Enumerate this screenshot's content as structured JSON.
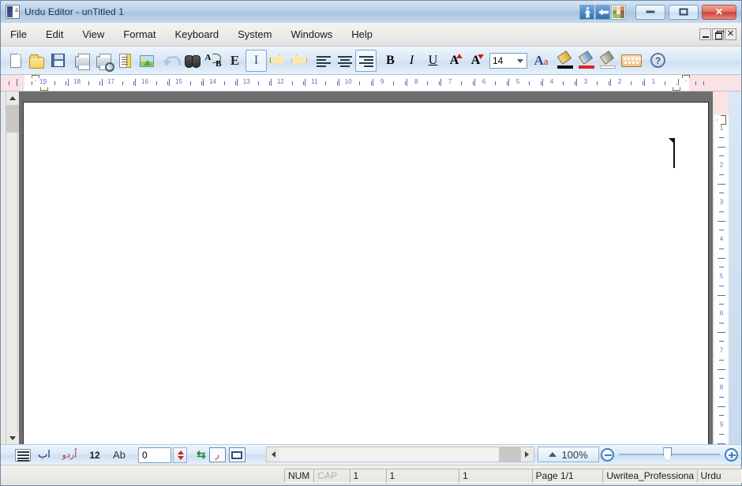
{
  "window": {
    "title": "Urdu Editor - unTitled 1",
    "app_icon": "urdu-editor-icon",
    "title_tools": [
      "person-icon",
      "left-arrow-icon",
      "color-palette-icon"
    ],
    "minimize_label": "",
    "maximize_label": "",
    "close_label": "✕"
  },
  "menu": {
    "items": [
      {
        "label": "File",
        "name": "menu-file"
      },
      {
        "label": "Edit",
        "name": "menu-edit"
      },
      {
        "label": "View",
        "name": "menu-view"
      },
      {
        "label": "Format",
        "name": "menu-format"
      },
      {
        "label": "Keyboard",
        "name": "menu-keyboard"
      },
      {
        "label": "System",
        "name": "menu-system"
      },
      {
        "label": "Windows",
        "name": "menu-windows"
      },
      {
        "label": "Help",
        "name": "menu-help"
      }
    ],
    "mdi": {
      "restore_title": "Restore",
      "minimize_title": "Minimize",
      "close_title": "Close",
      "close_glyph": "✕"
    }
  },
  "toolbar": {
    "buttons": [
      {
        "name": "new-document-button",
        "tip": "New"
      },
      {
        "name": "open-button",
        "tip": "Open"
      },
      {
        "name": "save-button",
        "tip": "Save"
      },
      {
        "name": "print-button",
        "tip": "Print"
      },
      {
        "name": "print-preview-button",
        "tip": "Print Preview"
      },
      {
        "name": "document-properties-button",
        "tip": "Document"
      },
      {
        "name": "insert-image-button",
        "tip": "Insert Image"
      },
      {
        "name": "undo-button",
        "tip": "Undo"
      },
      {
        "name": "find-button",
        "tip": "Find"
      },
      {
        "name": "replace-button",
        "tip": "Replace"
      },
      {
        "name": "english-mode-button",
        "tip": "English"
      },
      {
        "name": "urdu-mode-button",
        "tip": "Urdu"
      },
      {
        "name": "rtl-direction-button",
        "tip": "Right to Left"
      },
      {
        "name": "ltr-direction-button",
        "tip": "Left to Right"
      },
      {
        "name": "align-left-button",
        "tip": "Align Left"
      },
      {
        "name": "align-center-button",
        "tip": "Align Center"
      },
      {
        "name": "align-right-button",
        "tip": "Align Right"
      },
      {
        "name": "bold-button",
        "tip": "Bold"
      },
      {
        "name": "italic-button",
        "tip": "Italic"
      },
      {
        "name": "underline-button",
        "tip": "Underline"
      },
      {
        "name": "increase-font-button",
        "tip": "Increase Font Size"
      },
      {
        "name": "decrease-font-button",
        "tip": "Decrease Font Size"
      }
    ],
    "glyphs": {
      "english": "E",
      "urdu_info": "I",
      "bold": "B",
      "italic": "I",
      "underline": "U",
      "font_up": "A",
      "font_down": "A"
    },
    "font_size": {
      "value": "14",
      "placeholder": "14"
    },
    "font_button": {
      "big": "A",
      "small": "a"
    },
    "color_buttons": [
      {
        "name": "text-color-button",
        "color": "#000000"
      },
      {
        "name": "highlight-color-button",
        "color": "#e02020"
      },
      {
        "name": "background-color-button",
        "color": "#ffffff"
      }
    ],
    "keyboard_button": "on-screen-keyboard-button",
    "help_button": {
      "name": "help-button",
      "glyph": "?"
    }
  },
  "ruler": {
    "horizontal_numbers": [
      19,
      18,
      17,
      16,
      15,
      14,
      13,
      12,
      11,
      10,
      9,
      8,
      7,
      6,
      5,
      4,
      3,
      2,
      1
    ],
    "vertical_numbers": [
      1,
      2,
      3,
      4,
      5,
      6,
      7,
      8,
      9
    ]
  },
  "document": {
    "content": "",
    "caret_visible": true
  },
  "bottom_toolbar": {
    "items": [
      {
        "name": "line-spacing-button",
        "label": ""
      },
      {
        "name": "urdu-keyboard-button",
        "label": "اب"
      },
      {
        "name": "urdu-script-button",
        "label": "اُردو"
      },
      {
        "name": "line-number-display",
        "label": "12"
      },
      {
        "name": "case-button",
        "label": "Ab"
      }
    ],
    "spinner": {
      "name": "indent-spinner",
      "value": "0"
    },
    "extra_buttons": [
      {
        "name": "sync-button",
        "glyph": "⇆"
      },
      {
        "name": "urdu-convert-button",
        "glyph": ""
      },
      {
        "name": "window-preview-button",
        "glyph": ""
      }
    ]
  },
  "scrollbars": {
    "h_left_arrow": "‹",
    "h_right_arrow": "›",
    "v_up_arrow": "▲",
    "v_down_arrow": "▼"
  },
  "zoom": {
    "label": "100%",
    "minus": "−",
    "plus": "+"
  },
  "statusbar": {
    "num_lock": "NUM",
    "caps_lock": "CAP",
    "field1": "1",
    "field2": "1",
    "field3": "1",
    "page": "Page 1/1",
    "font": "Uwritea_Professiona",
    "language": "Urdu"
  },
  "colors": {
    "titlebar_start": "#d4e4f4",
    "titlebar_end": "#a9c4e0",
    "accent_blue": "#3f7fbf",
    "close_red": "#c8403a",
    "ruler_margin": "#fbe2e4",
    "page_bg": "#ffffff",
    "workarea_bg": "#6e6e6e"
  }
}
